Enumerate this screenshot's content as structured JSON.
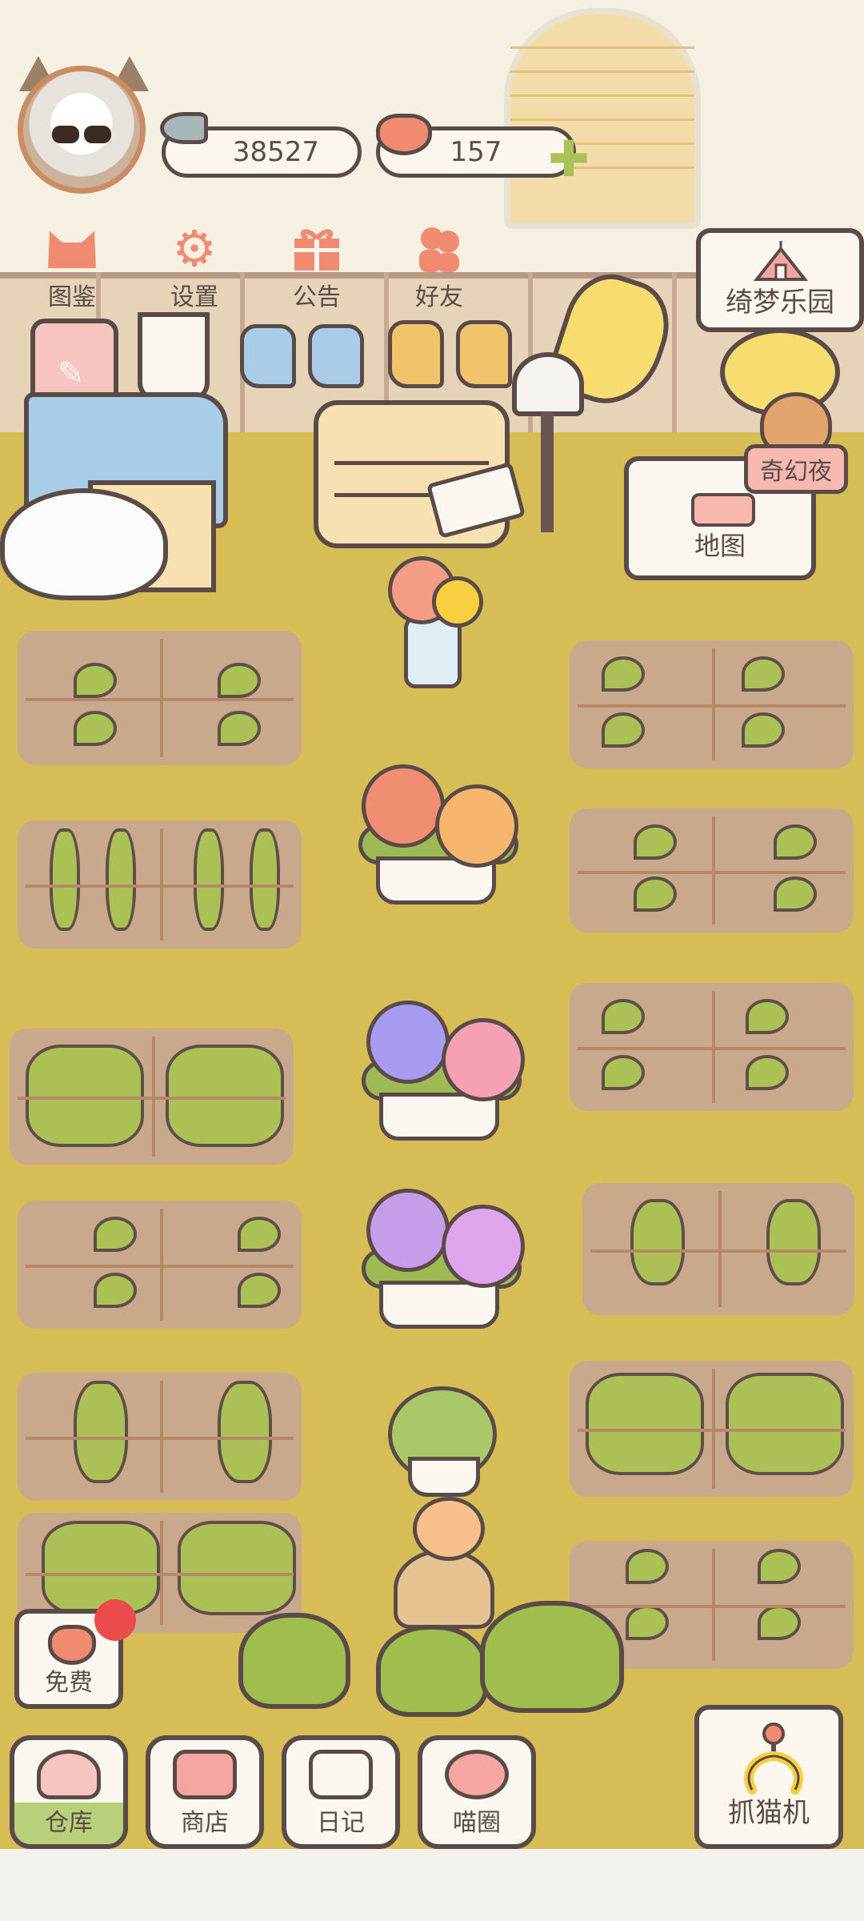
{
  "stats": {
    "fish_value": "38527",
    "heart_value": "157"
  },
  "top_menu": [
    {
      "label": "图鉴",
      "icon": "cat-head-icon"
    },
    {
      "label": "设置",
      "icon": "gear-icon"
    },
    {
      "label": "公告",
      "icon": "gift-icon"
    },
    {
      "label": "好友",
      "icon": "friends-icon"
    }
  ],
  "signs": {
    "park": "绮梦乐园",
    "night": "奇幻夜",
    "map": "地图"
  },
  "free_button": {
    "label": "免费"
  },
  "bottom_bar": [
    {
      "label": "仓库",
      "icon": "bowl-icon"
    },
    {
      "label": "商店",
      "icon": "shop-icon"
    },
    {
      "label": "日记",
      "icon": "diary-icon"
    },
    {
      "label": "喵圈",
      "icon": "planet-cat-icon"
    }
  ],
  "claw_machine": {
    "label": "抓猫机",
    "icon": "claw-icon"
  },
  "colors": {
    "ground": "#d7bd55",
    "outline": "#5a4a48",
    "accent_coral": "#f08b72",
    "badge_red": "#ec4b4b",
    "leaf_green": "#a9c257"
  }
}
